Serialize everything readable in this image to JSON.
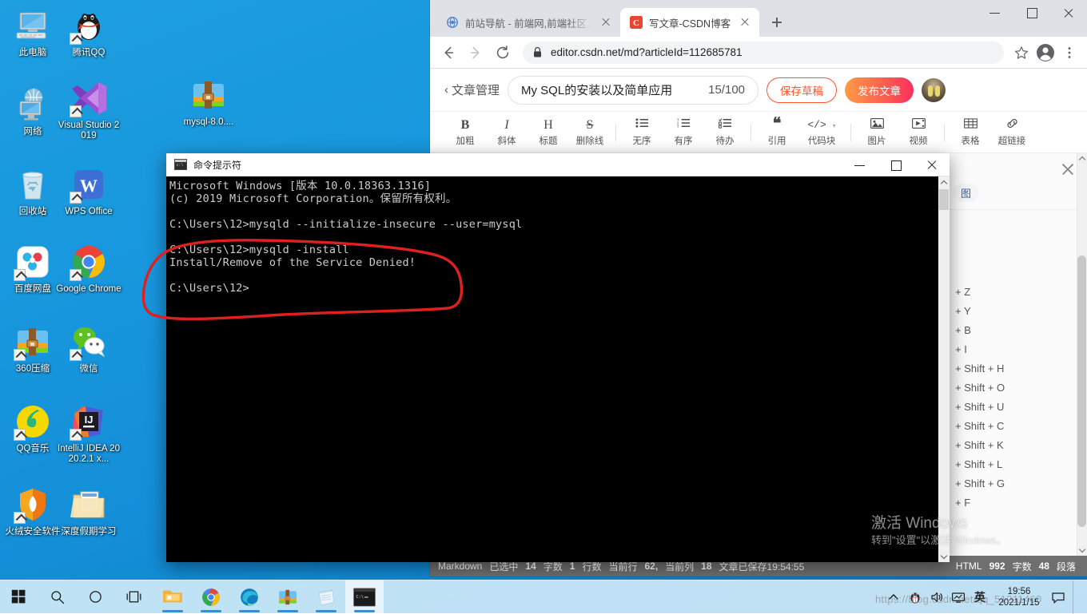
{
  "desktop": {
    "icons": [
      {
        "label": "此电脑",
        "icon": "this-pc-icon",
        "shortcut": false
      },
      {
        "label": "腾讯QQ",
        "icon": "tencent-qq-icon",
        "shortcut": true
      },
      {
        "label": "网络",
        "icon": "network-icon",
        "shortcut": false
      },
      {
        "label": "Visual Studio 2019",
        "icon": "visual-studio-icon",
        "shortcut": true
      },
      {
        "label": "回收站",
        "icon": "recycle-bin-icon",
        "shortcut": false
      },
      {
        "label": "WPS Office",
        "icon": "wps-office-icon",
        "shortcut": true
      },
      {
        "label": "百度网盘",
        "icon": "baidu-netdisk-icon",
        "shortcut": true
      },
      {
        "label": "Google Chrome",
        "icon": "chrome-icon",
        "shortcut": true
      },
      {
        "label": "360压缩",
        "icon": "360-zip-icon",
        "shortcut": true
      },
      {
        "label": "微信",
        "icon": "wechat-icon",
        "shortcut": true
      },
      {
        "label": "QQ音乐",
        "icon": "qq-music-icon",
        "shortcut": true
      },
      {
        "label": "IntelliJ IDEA 2020.2.1 x...",
        "icon": "intellij-idea-icon",
        "shortcut": true
      },
      {
        "label": "火绒安全软件",
        "icon": "huorong-security-icon",
        "shortcut": true
      },
      {
        "label": "深度假期学习",
        "icon": "folder-icon",
        "shortcut": false
      },
      {
        "label": "mysql-8.0....",
        "icon": "archive-icon",
        "shortcut": false
      }
    ]
  },
  "browser": {
    "tabs": [
      {
        "title": "前站导航 - 前端网,前端社区,搜索",
        "favicon": "globe-icon",
        "active": false
      },
      {
        "title": "写文章-CSDN博客",
        "favicon": "csdn-icon",
        "active": true
      }
    ],
    "new_tab_label": "+",
    "window_controls": {
      "minimize": "−",
      "maximize": "□",
      "close": "×"
    },
    "url": "editor.csdn.net/md?articleId=112685781",
    "nav": {
      "back": "←",
      "forward": "→",
      "reload": "⟳"
    },
    "lock_icon": "lock-icon",
    "bookmark_icon": "star-icon",
    "profile_icon": "account-icon",
    "menu_icon": "kebab-menu-icon"
  },
  "csdn": {
    "back_label": "文章管理",
    "back_chevron": "‹",
    "article_title": "My SQL的安装以及简单应用",
    "title_counter": "15/100",
    "save_draft_label": "保存草稿",
    "publish_label": "发布文章",
    "avatar_name": "user-avatar",
    "toolbar": [
      {
        "icon": "B",
        "name": "bold-icon",
        "label": "加粗"
      },
      {
        "icon": "I",
        "name": "italic-icon",
        "label": "斜体"
      },
      {
        "icon": "H",
        "name": "heading-icon",
        "label": "标题"
      },
      {
        "icon": "S",
        "name": "strikethrough-icon",
        "label": "删除线"
      },
      {
        "icon": "sep",
        "name": "toolbar-separator",
        "label": ""
      },
      {
        "icon": "☰",
        "name": "unordered-list-icon",
        "label": "无序"
      },
      {
        "icon": "☰",
        "name": "ordered-list-icon",
        "label": "有序"
      },
      {
        "icon": "☰",
        "name": "todo-list-icon",
        "label": "待办"
      },
      {
        "icon": "❝",
        "name": "quote-icon",
        "label": "引用"
      },
      {
        "icon": "</>",
        "name": "code-block-icon",
        "label": "代码块"
      },
      {
        "icon": "sep",
        "name": "toolbar-separator",
        "label": ""
      },
      {
        "icon": "▣",
        "name": "image-icon",
        "label": "图片"
      },
      {
        "icon": "▶",
        "name": "video-icon",
        "label": "视频"
      },
      {
        "icon": "sep",
        "name": "toolbar-separator",
        "label": ""
      },
      {
        "icon": "▦",
        "name": "table-icon",
        "label": "表格"
      },
      {
        "icon": "🔗",
        "name": "hyperlink-icon",
        "label": "超链接"
      }
    ],
    "panel": {
      "close_label": "×",
      "tag": "图",
      "shortcuts": [
        "+ Z",
        "+ Y",
        "+ B",
        "+ I",
        "+ Shift + H",
        "+ Shift + O",
        "+ Shift + U",
        "+ Shift + C",
        "+ Shift + K",
        "+ Shift + L",
        "+ Shift + G",
        "+ F"
      ]
    },
    "status": {
      "mode": "Markdown",
      "selected_label": "已选中",
      "char_count": "14",
      "char_unit": "字数",
      "line_count": "1",
      "line_unit": "行数",
      "cursor_label": "当前行",
      "cursor_row": "62,",
      "cursor_col_label": "当前列",
      "cursor_col": "18",
      "saved_label": "文章已保存19:54:55",
      "right_mode": "HTML",
      "right_count": "992",
      "right_count_unit": "字数",
      "right_para": "48",
      "right_para_unit": "段落"
    }
  },
  "cmd": {
    "title": "命令提示符",
    "icon": "console-icon",
    "window_controls": {
      "minimize": "−",
      "maximize": "□",
      "close": "×"
    },
    "lines": [
      "Microsoft Windows [版本 10.0.18363.1316]",
      "(c) 2019 Microsoft Corporation。保留所有权利。",
      "",
      "C:\\Users\\12>mysqld --initialize-insecure --user=mysql",
      "",
      "C:\\Users\\12>mysqld -install",
      "Install/Remove of the Service Denied!",
      "",
      "C:\\Users\\12>"
    ],
    "annotation_color": "#e02020"
  },
  "watermark": {
    "activate_title": "激活 Windows",
    "activate_sub": "转到\"设置\"以激活 Windows。",
    "url_text": "https://blog.csdn.net/qq_51211460"
  },
  "taskbar": {
    "items": [
      {
        "name": "start-button",
        "icon": "windows-logo-icon",
        "running": false
      },
      {
        "name": "search-button",
        "icon": "search-icon",
        "running": false
      },
      {
        "name": "cortana-button",
        "icon": "cortana-circle-icon",
        "running": false
      },
      {
        "name": "task-view-button",
        "icon": "task-view-icon",
        "running": false
      },
      {
        "name": "file-explorer-button",
        "icon": "folder-icon",
        "running": true
      },
      {
        "name": "chrome-button",
        "icon": "chrome-icon",
        "running": true
      },
      {
        "name": "edge-button",
        "icon": "edge-icon",
        "running": true
      },
      {
        "name": "360-zip-button",
        "icon": "360-zip-icon",
        "running": true
      },
      {
        "name": "notepad-button",
        "icon": "notepad-icon",
        "running": true
      },
      {
        "name": "cmd-button",
        "icon": "console-icon",
        "running": true,
        "active": true
      }
    ],
    "tray": [
      {
        "name": "show-hidden-icons",
        "icon": "chevron-up-icon"
      },
      {
        "name": "qq-tray-icon",
        "icon": "penguin-icon"
      },
      {
        "name": "volume-tray-icon",
        "icon": "speaker-icon"
      },
      {
        "name": "network-tray-icon",
        "icon": "monitor-icon"
      },
      {
        "name": "ime-tray-icon",
        "icon": "ime-chinese-icon",
        "text": "英"
      }
    ],
    "clock_time": "19:56",
    "clock_date": "2021/1/15",
    "action_center_icon": "notification-icon"
  },
  "colors": {
    "desktop_blue": "#1796dd",
    "csdn_red": "#fc5531",
    "publish_gradient_start": "#ff9b44",
    "publish_gradient_end": "#fc2f5b",
    "annotation_red": "#e02020",
    "status_bar_gray": "#6f6f6f",
    "taskbar": "#cde8f8"
  }
}
